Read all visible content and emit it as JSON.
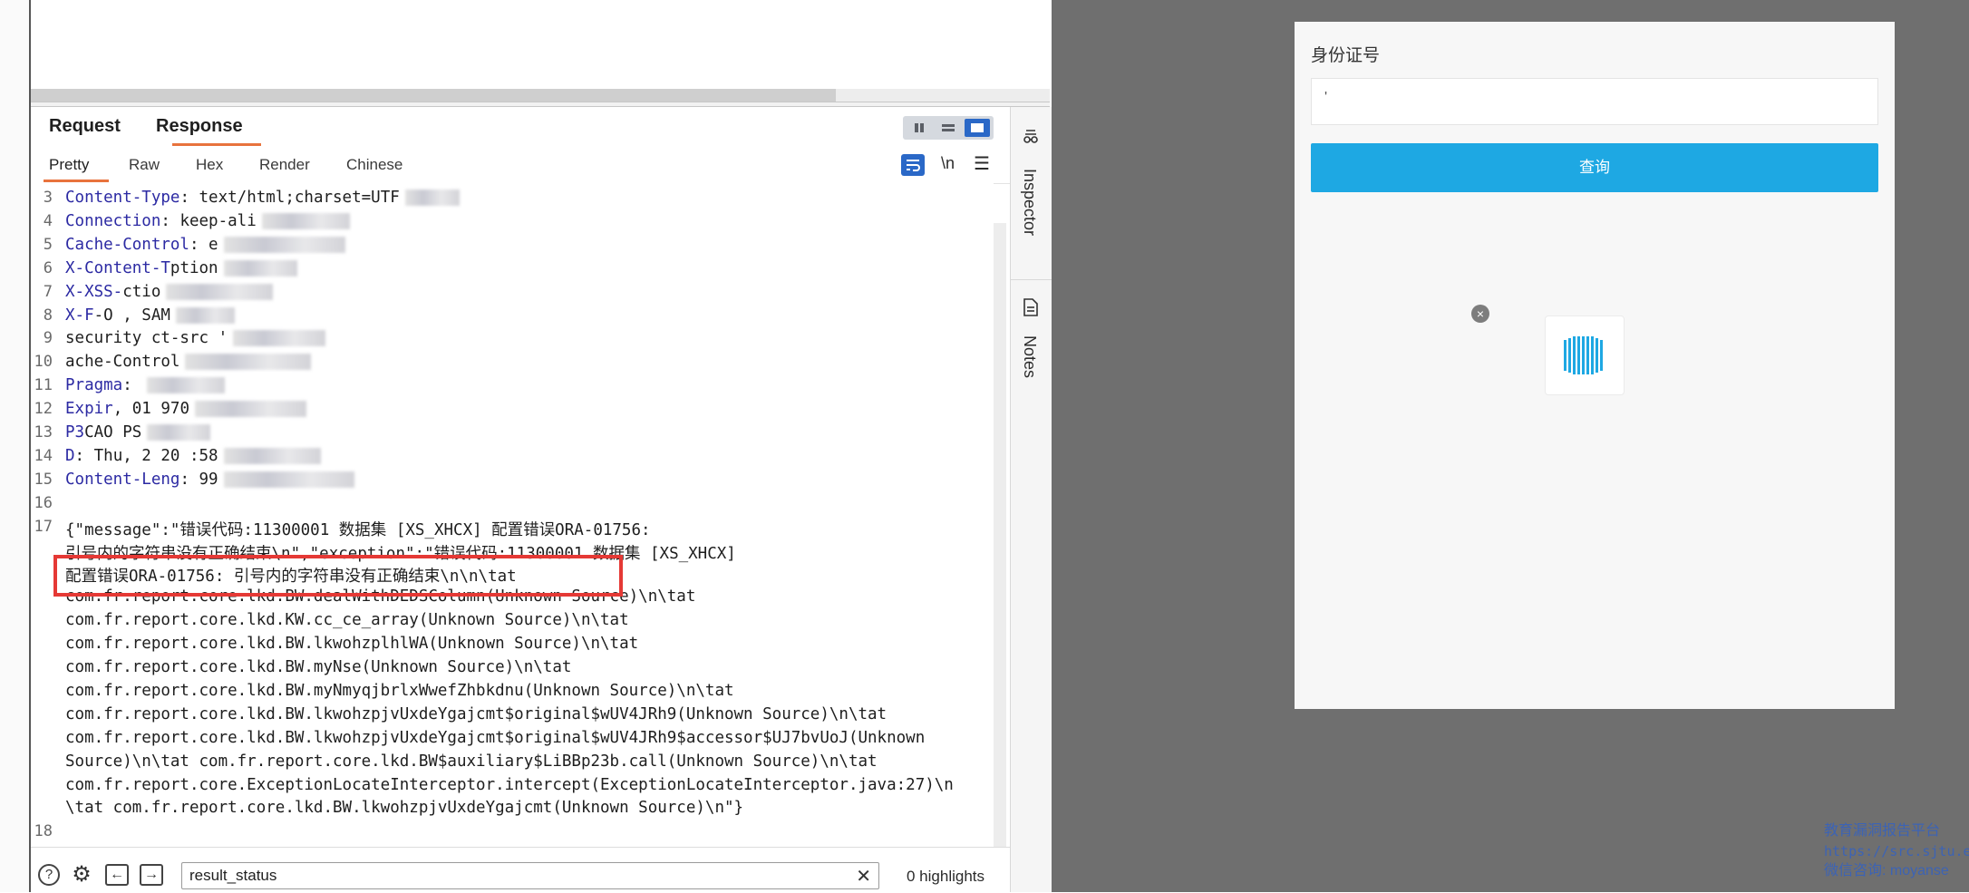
{
  "burp": {
    "tabs": {
      "request": "Request",
      "response": "Response"
    },
    "subtabs": {
      "pretty": "Pretty",
      "raw": "Raw",
      "hex": "Hex",
      "render": "Render",
      "chinese": "Chinese"
    },
    "toolbar": {
      "newline": "\\n",
      "menu": "☰"
    },
    "lines": [
      {
        "n": "3",
        "name": "Content-Type",
        "sep": ": ",
        "value": "text/html;charset=UTF"
      },
      {
        "n": "4",
        "name": "Connection",
        "sep": ": ",
        "value": "keep-ali"
      },
      {
        "n": "5",
        "name": "Cache-Control",
        "sep": ": ",
        "value": "e"
      },
      {
        "n": "6",
        "name": "X-Content-T",
        "sep": "",
        "value": "ption"
      },
      {
        "n": "7",
        "name": "X-XSS-",
        "sep": "",
        "value": "ctio"
      },
      {
        "n": "8",
        "name": "X-F",
        "sep": "",
        "value": "-O , SAM"
      },
      {
        "n": "9",
        "name": "",
        "sep": "",
        "value": "security ct-src '"
      },
      {
        "n": "10",
        "name": "",
        "sep": "",
        "value": "ache-Control"
      },
      {
        "n": "11",
        "name": "Pragma",
        "sep": ": ",
        "value": ""
      },
      {
        "n": "12",
        "name": "Expir",
        "sep": "",
        "value": ", 01 970"
      },
      {
        "n": "13",
        "name": "P3",
        "sep": "",
        "value": "CAO PS"
      },
      {
        "n": "14",
        "name": "D",
        "sep": "",
        "value": ": Thu, 2 20 :58"
      },
      {
        "n": "15",
        "name": "Content-Leng",
        "sep": "",
        "value": ": 99"
      },
      {
        "n": "16",
        "name": "",
        "sep": "",
        "value": ""
      }
    ],
    "body_line_number": "17",
    "body_lines": [
      "{\"message\":\"错误代码:11300001 数据集 [XS_XHCX] 配置错误ORA-01756:",
      "引号内的字符串没有正确结束\\n\",\"exception\":\"错误代码:11300001 数据集 [XS_XHCX]",
      "配置错误ORA-01756: 引号内的字符串没有正确结束\\n\\n\\tat",
      "com.fr.report.core.lkd.BW.dealWithDEDSColumn(Unknown Source)\\n\\tat",
      "com.fr.report.core.lkd.KW.cc_ce_array(Unknown Source)\\n\\tat",
      "com.fr.report.core.lkd.BW.lkwohzplhlWA(Unknown Source)\\n\\tat",
      "com.fr.report.core.lkd.BW.myNse(Unknown Source)\\n\\tat",
      "com.fr.report.core.lkd.BW.myNmyqjbrlxWwefZhbkdnu(Unknown Source)\\n\\tat",
      "com.fr.report.core.lkd.BW.lkwohzpjvUxdeYgajcmt$original$wUV4JRh9(Unknown Source)\\n\\tat",
      "com.fr.report.core.lkd.BW.lkwohzpjvUxdeYgajcmt$original$wUV4JRh9$accessor$UJ7bvUoJ(Unknown",
      "Source)\\n\\tat com.fr.report.core.lkd.BW$auxiliary$LiBBp23b.call(Unknown Source)\\n\\tat",
      "com.fr.report.core.ExceptionLocateInterceptor.intercept(ExceptionLocateInterceptor.java:27)\\n",
      "\\tat com.fr.report.core.lkd.BW.lkwohzpjvUxdeYgajcmt(Unknown Source)\\n\"}"
    ],
    "last_line_number": "18",
    "search": {
      "value": "result_status",
      "clear": "✕",
      "highlights": "0 highlights"
    },
    "bottom_icons": {
      "help": "?",
      "settings": "⚙",
      "back": "←",
      "forward": "→"
    },
    "rail": {
      "inspector": "Inspector",
      "notes": "Notes"
    },
    "colors": {
      "accent": "#e8733d",
      "header_name": "#2c2aa3",
      "highlight_box": "#e53935",
      "active_blue": "#2a68c7"
    }
  },
  "browser": {
    "field_label": "身份证号",
    "field_value": "'",
    "query_button": "查询",
    "loader_close": "×",
    "button_color": "#1ea8e3",
    "watermark": {
      "line1": "教育漏洞报告平台",
      "line2": "https://src.sjtu.e",
      "line3": "微信咨询: moyanse"
    }
  }
}
